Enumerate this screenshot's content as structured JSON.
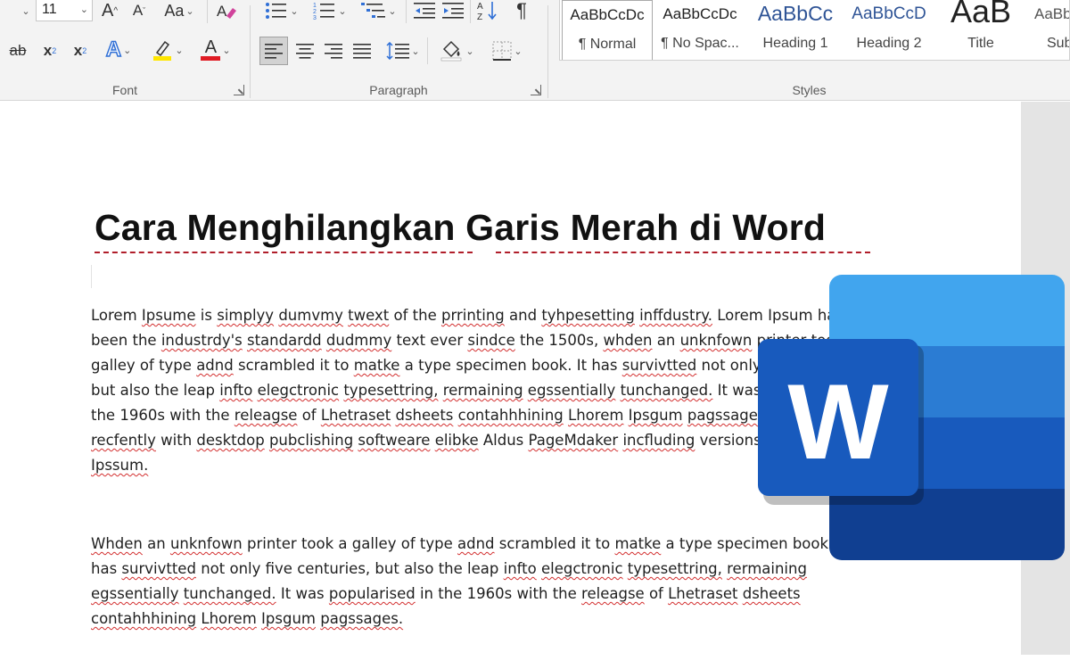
{
  "ribbon": {
    "font": {
      "label": "Font",
      "size_value": "11",
      "grow_glyph": "A",
      "shrink_glyph": "A",
      "case_glyph": "Aa",
      "strike_glyph": "ab",
      "sub_glyph": "x",
      "sup_glyph": "x",
      "effects_glyph": "A",
      "fontcolor_glyph": "A"
    },
    "paragraph": {
      "label": "Paragraph"
    },
    "styles": {
      "label": "Styles",
      "items": [
        {
          "preview": "AaBbCcDc",
          "name": "¶ Normal"
        },
        {
          "preview": "AaBbCcDc",
          "name": "¶ No Spac..."
        },
        {
          "preview": "AaBbCc",
          "name": "Heading 1"
        },
        {
          "preview": "AaBbCcD",
          "name": "Heading 2"
        },
        {
          "preview": "AaB",
          "name": "Title"
        },
        {
          "preview": "AaBbC",
          "name": "Sub"
        }
      ]
    }
  },
  "document": {
    "title": "Cara Menghilangkan Garis Merah di Word",
    "para1": [
      "Lorem Ipsume is simplyy dumvmy twext of the prrinting and tyhpesetting inffdustry. Lorem Ipsum has",
      "been the industrdy's standardd dudmmy text ever sindce the 1500s, whden an unknfown printer took a",
      "galley of type adnd scrambled it to matke a type specimen book. It has survivtted not only five centuries,",
      "but also the leap infto elegctronic typesettring, rermaining egssentially tunchanged. It was popularised in",
      "the 1960s with the releagse of Lhetraset dsheets contahhhining Lhorem Ipsgum pagssages, and more",
      "recfently with desktdop pubclishing softweare elibke Aldus PageMdaker incfluding versions of Lorem",
      "Ipssum."
    ],
    "para2": [
      "Whden an unknfown printer took a galley of type adnd scrambled it to matke a type specimen book. It",
      "has survivtted not only five centuries, but also the leap infto elegctronic typesettring, rermaining",
      "egssentially tunchanged. It was popularised in the 1960s with the releagse of Lhetraset dsheets",
      "contahhhining Lhorem Ipsgum pagssages."
    ]
  },
  "logo": {
    "letter": "W",
    "colors": {
      "light": "#41a5ee",
      "mid": "#2b7cd3",
      "dark": "#185abd",
      "darkest": "#103f91"
    }
  },
  "colors": {
    "ribbon_bg": "#f3f3f3",
    "squiggle": "#d32f2f",
    "highlight_yellow": "#ffe600",
    "font_red": "#e01b24",
    "effects_blue": "#2f6fd6"
  }
}
